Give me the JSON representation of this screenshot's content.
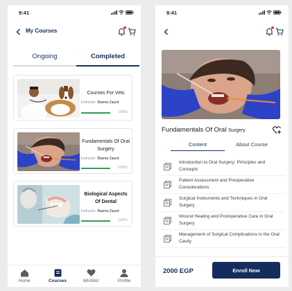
{
  "colors": {
    "primary": "#152d5c",
    "progress": "#2e9c5b",
    "notification": "#e53935"
  },
  "left_screen": {
    "status_time": "9:41",
    "title": "My Courses",
    "tabs": [
      {
        "label": "Ongoing",
        "active": false
      },
      {
        "label": "Completed",
        "active": true
      }
    ],
    "courses": [
      {
        "title": "Courses For Vets",
        "instructor_label": "Instructor:",
        "instructor": "Basma Zayed",
        "progress_percent": 100,
        "progress_label": "100%"
      },
      {
        "title": "Fundamentals Of Oral Surgery",
        "instructor_label": "Instructor:",
        "instructor": "Basma Zayed",
        "progress_percent": 100,
        "progress_label": "100%"
      },
      {
        "title": "Biological Aspects Of Dental",
        "instructor_label": "Instructor:",
        "instructor": "Basma Zayed",
        "progress_percent": 100,
        "progress_label": "100%"
      }
    ],
    "nav": [
      {
        "label": "Home",
        "icon": "home-icon",
        "active": false
      },
      {
        "label": "Courses",
        "icon": "courses-icon",
        "active": true
      },
      {
        "label": "Wishlist",
        "icon": "heart-icon",
        "active": false
      },
      {
        "label": "Profile",
        "icon": "profile-icon",
        "active": false
      }
    ]
  },
  "right_screen": {
    "status_time": "9:41",
    "course_title": "Fundamentals Of Oral",
    "course_title_suffix": "Surgery",
    "tabs": [
      {
        "label": "Content",
        "active": true
      },
      {
        "label": "About Course",
        "active": false
      }
    ],
    "lessons": [
      "Introduction to Oral Surgery: Principles and Concepts",
      "Patient Assessment and Preoperative Considerations",
      "Surgical Instruments and Techniques in Oral Surgery",
      "Wound Healing and Postoperative Care in Oral Surgery",
      "Management of Surgical Complications in the Oral Cavity"
    ],
    "price": "2000 EGP",
    "enroll_label": "Enroll Now"
  }
}
